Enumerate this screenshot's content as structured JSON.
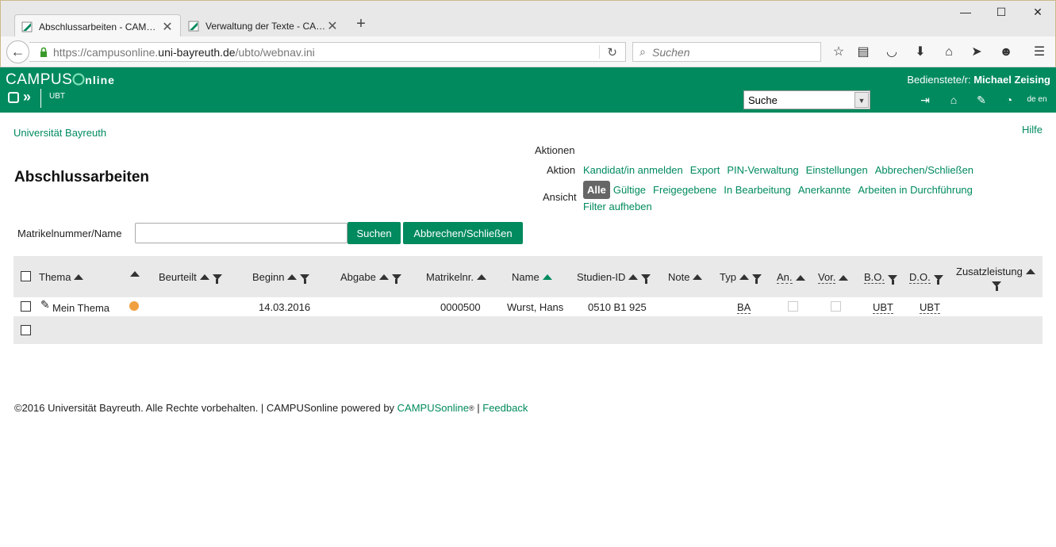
{
  "browser": {
    "tabs": [
      {
        "title": "Abschlussarbeiten - CAM…",
        "close": "✕"
      },
      {
        "title": "Verwaltung der Texte - CA…",
        "close": "✕"
      }
    ],
    "new_tab": "+",
    "window_controls": {
      "minimize": "—",
      "maximize": "☐",
      "close": "✕"
    },
    "url_prefix": "https://campusonline.",
    "url_host": "uni-bayreuth.de",
    "url_path": "/ubto/webnav.ini",
    "search_placeholder": "Suchen"
  },
  "app_header": {
    "logo_campus": "CAMPUS",
    "logo_online": "nline",
    "org": "UBT",
    "user_prefix": "Bedienstete/r: ",
    "user_name": "Michael Zeising",
    "select_value": "Suche",
    "lang_label": "de en"
  },
  "page": {
    "university": "Universität Bayreuth",
    "help": "Hilfe",
    "title": "Abschlussarbeiten",
    "aktionen_heading": "Aktionen",
    "aktion_label": "Aktion",
    "aktion_links": [
      "Kandidat/in anmelden",
      "Export",
      "PIN-Verwaltung",
      "Einstellungen",
      "Abbrechen/Schließen"
    ],
    "ansicht_label": "Ansicht",
    "ansicht_active": "Alle",
    "ansicht_links": [
      "Gültige",
      "Freigegebene",
      "In Bearbeitung",
      "Anerkannte",
      "Arbeiten in Durchführung"
    ],
    "filter_link": "Filter aufheben",
    "search_label": "Matrikelnummer/Name",
    "search_value": "",
    "search_button": "Suchen",
    "cancel_button": "Abbrechen/Schließen"
  },
  "table": {
    "headers": {
      "thema": "Thema",
      "beurteilt": "Beurteilt",
      "beginn": "Beginn",
      "abgabe": "Abgabe",
      "matrikel": "Matrikelnr.",
      "name": "Name",
      "studien_id": "Studien-ID",
      "note": "Note",
      "typ": "Typ",
      "an": "An.",
      "vor": "Vor.",
      "bo": "B.O.",
      "do": "D.O.",
      "zusatz": "Zusatzleistung"
    },
    "row": {
      "thema": "Mein Thema",
      "status_color": "#f0a040",
      "beginn": "14.03.2016",
      "matrikel": "0000500",
      "name": "Wurst, Hans",
      "studien_id": "0510 B1 925",
      "typ": "BA",
      "bo": "UBT",
      "do": "UBT"
    }
  },
  "footer": {
    "text": "©2016 Universität Bayreuth. Alle Rechte vorbehalten. | CAMPUSonline powered by ",
    "brand_link": "CAMPUSonline",
    "registered": "®",
    "separator": " | ",
    "feedback": "Feedback"
  },
  "colors": {
    "brand_green": "#008a5e",
    "header_gray": "#e9e9e9"
  }
}
